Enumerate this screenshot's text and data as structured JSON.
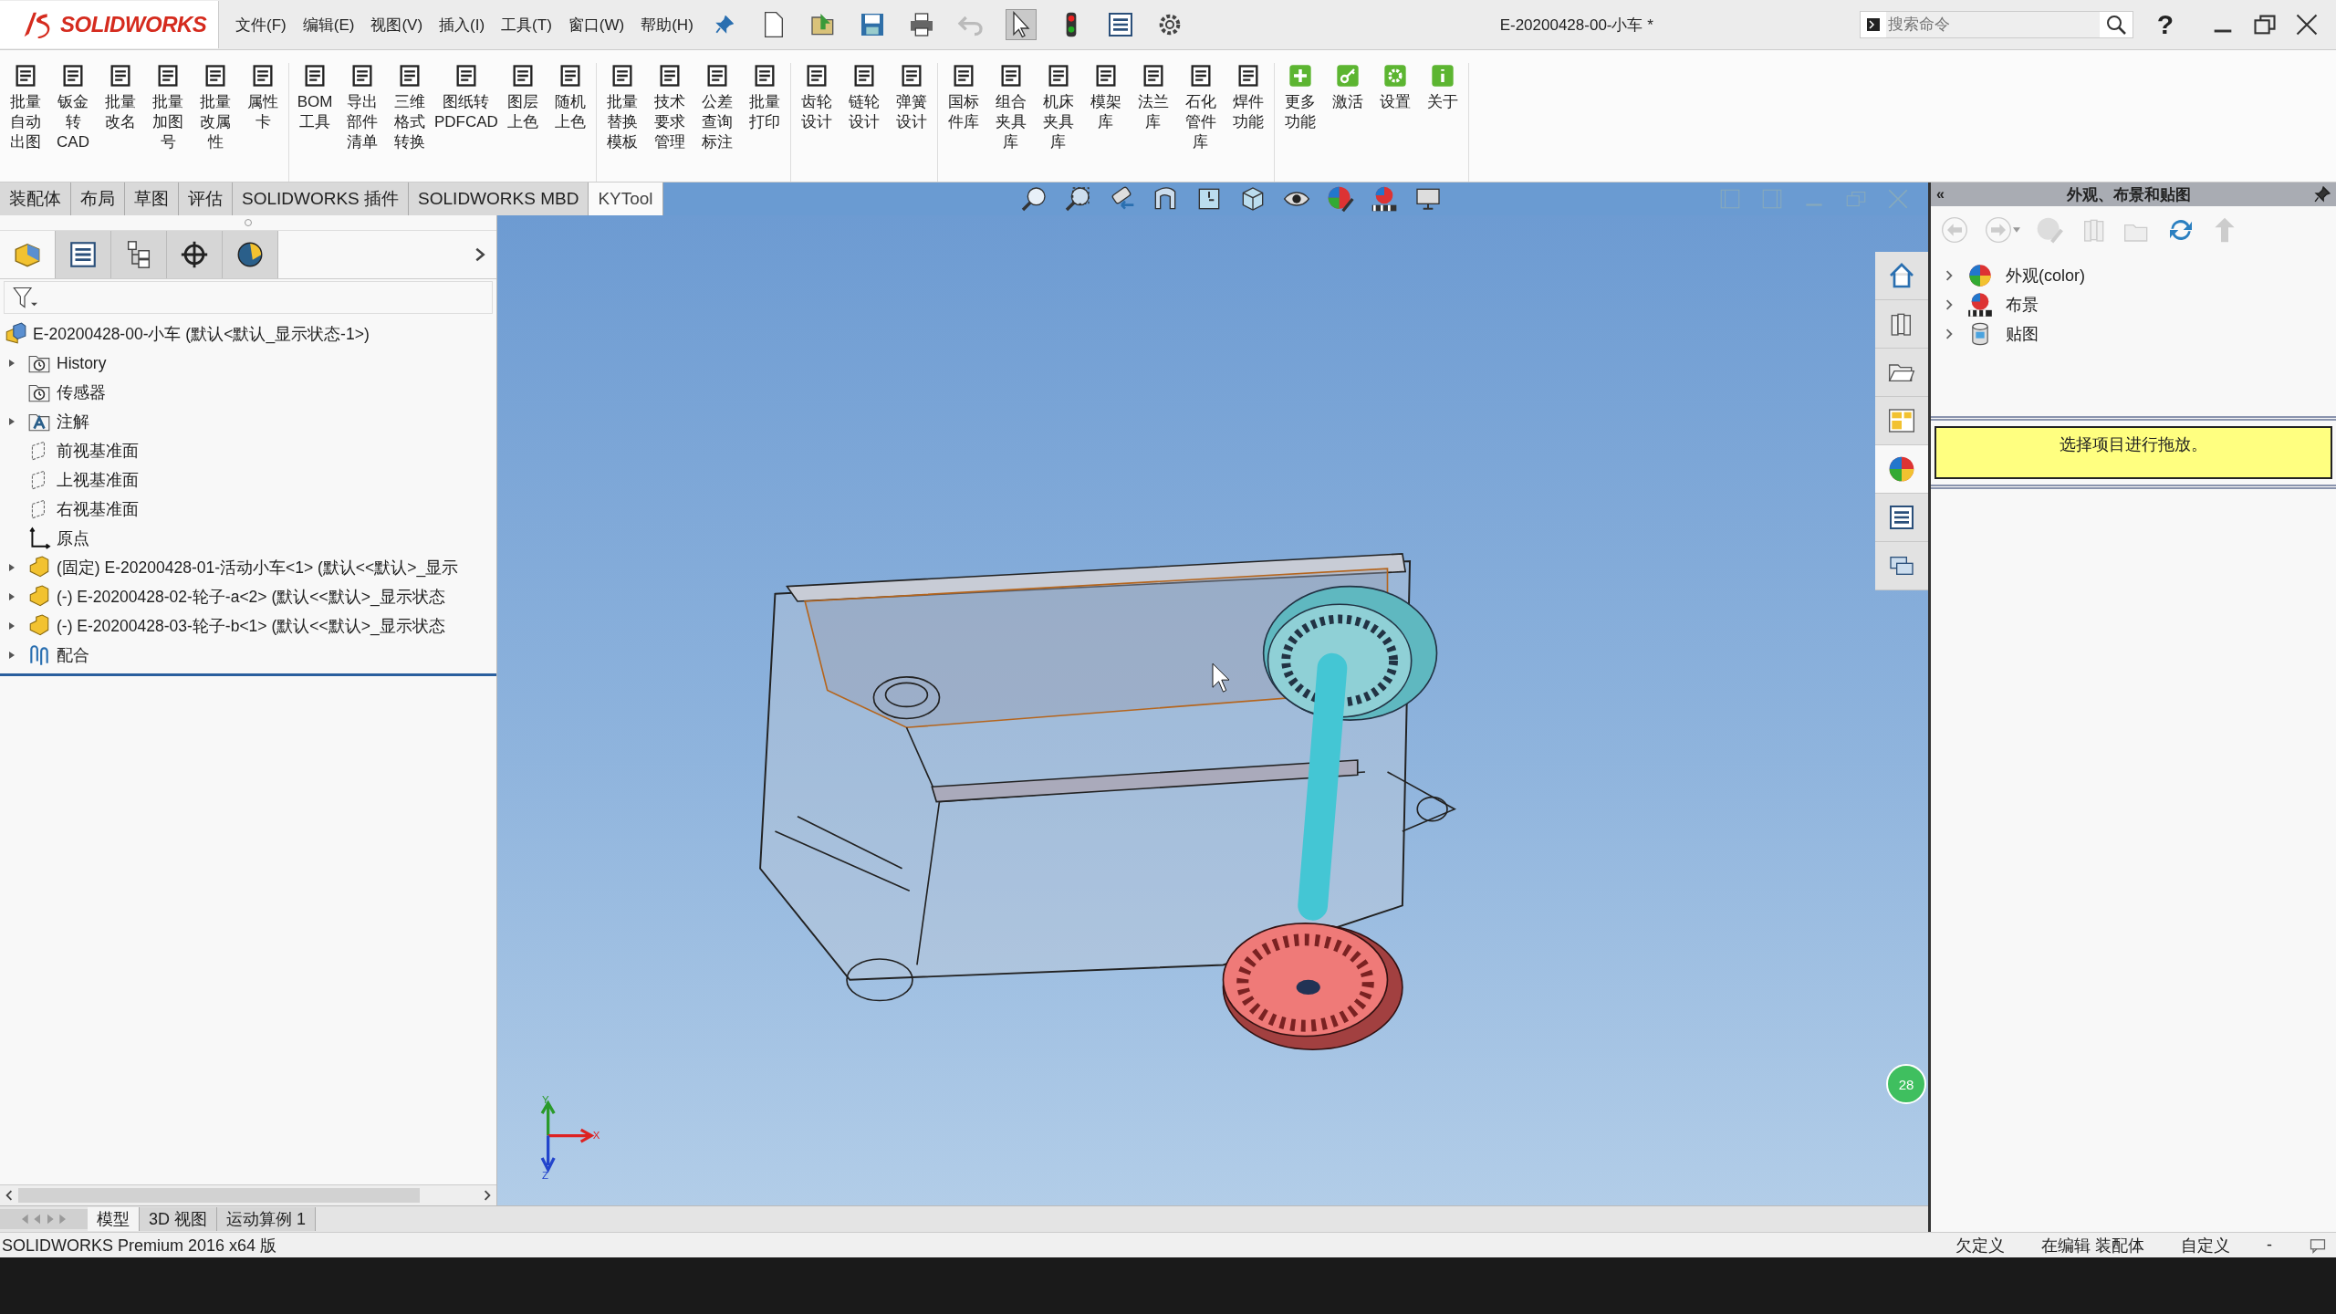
{
  "app": {
    "logo": "SOLIDWORKS",
    "title": "E-20200428-00-小车 *"
  },
  "menu": [
    "文件(F)",
    "编辑(E)",
    "视图(V)",
    "插入(I)",
    "工具(T)",
    "窗口(W)",
    "帮助(H)"
  ],
  "search": {
    "placeholder": "搜索命令"
  },
  "help": "?",
  "ribbon": [
    [
      {
        "label": "批量自动出图"
      },
      {
        "label": "钣金转CAD"
      },
      {
        "label": "批量改名"
      },
      {
        "label": "批量加图号"
      },
      {
        "label": "批量改属性"
      },
      {
        "label": "属性卡"
      }
    ],
    [
      {
        "label": "BOM工具"
      },
      {
        "label": "导出部件清单"
      },
      {
        "label": "三维格式转换"
      },
      {
        "label": "图纸转PDFCAD"
      },
      {
        "label": "图层上色"
      },
      {
        "label": "随机上色"
      }
    ],
    [
      {
        "label": "批量替换模板"
      },
      {
        "label": "技术要求管理"
      },
      {
        "label": "公差查询标注"
      },
      {
        "label": "批量打印"
      }
    ],
    [
      {
        "label": "齿轮设计"
      },
      {
        "label": "链轮设计"
      },
      {
        "label": "弹簧设计"
      }
    ],
    [
      {
        "label": "国标件库"
      },
      {
        "label": "组合夹具库"
      },
      {
        "label": "机床夹具库"
      },
      {
        "label": "模架库"
      },
      {
        "label": "法兰库"
      },
      {
        "label": "石化管件库"
      },
      {
        "label": "焊件功能"
      }
    ],
    [
      {
        "label": "更多功能"
      },
      {
        "label": "激活"
      },
      {
        "label": "设置"
      },
      {
        "label": "关于"
      }
    ]
  ],
  "command_tabs": [
    {
      "label": "装配体",
      "selected": false
    },
    {
      "label": "布局",
      "selected": false
    },
    {
      "label": "草图",
      "selected": false
    },
    {
      "label": "评估",
      "selected": false
    },
    {
      "label": "SOLIDWORKS 插件",
      "selected": false
    },
    {
      "label": "SOLIDWORKS MBD",
      "selected": false
    },
    {
      "label": "KYTool",
      "selected": true
    }
  ],
  "panel_tabs": [
    {
      "selected": true
    },
    {
      "selected": false
    },
    {
      "selected": false
    },
    {
      "selected": false
    },
    {
      "selected": false
    }
  ],
  "tree": {
    "root": "E-20200428-00-小车  (默认<默认_显示状态-1>)",
    "children": [
      {
        "label": "History",
        "kind": "history",
        "expandable": true
      },
      {
        "label": "传感器",
        "kind": "sensor",
        "expandable": false
      },
      {
        "label": "注解",
        "kind": "annotation",
        "expandable": true
      },
      {
        "label": "前视基准面",
        "kind": "plane",
        "expandable": false
      },
      {
        "label": "上视基准面",
        "kind": "plane",
        "expandable": false
      },
      {
        "label": "右视基准面",
        "kind": "plane",
        "expandable": false
      },
      {
        "label": "原点",
        "kind": "origin",
        "expandable": false
      },
      {
        "label": "(固定) E-20200428-01-活动小车<1> (默认<<默认>_显示",
        "kind": "part",
        "expandable": true
      },
      {
        "label": "(-) E-20200428-02-轮子-a<2> (默认<<默认>_显示状态",
        "kind": "part",
        "expandable": true
      },
      {
        "label": "(-) E-20200428-03-轮子-b<1> (默认<<默认>_显示状态",
        "kind": "part",
        "expandable": true
      },
      {
        "label": "配合",
        "kind": "mates",
        "expandable": true
      }
    ]
  },
  "triad": {
    "x": "X",
    "y": "Y",
    "z": "Z"
  },
  "badge": "28",
  "task_pane_tabs": [
    {
      "selected": false
    },
    {
      "selected": false
    },
    {
      "selected": false
    },
    {
      "selected": false
    },
    {
      "selected": true
    },
    {
      "selected": false
    },
    {
      "selected": false
    }
  ],
  "task_pane": {
    "collapse": "«",
    "title": "外观、布景和贴图",
    "items": [
      {
        "label": "外观(color)",
        "kind": "appearance"
      },
      {
        "label": "布景",
        "kind": "scene"
      },
      {
        "label": "贴图",
        "kind": "decal"
      }
    ],
    "hint": "选择项目进行拖放。"
  },
  "model_tabs": [
    {
      "label": "模型",
      "selected": true
    },
    {
      "label": "3D 视图",
      "selected": false
    },
    {
      "label": "运动算例 1",
      "selected": false
    }
  ],
  "status_bar": {
    "product": "SOLIDWORKS Premium 2016 x64 版",
    "fields": [
      "欠定义",
      "在编辑 装配体",
      "自定义",
      "-"
    ]
  }
}
